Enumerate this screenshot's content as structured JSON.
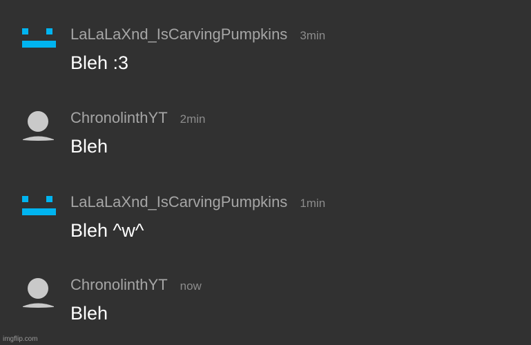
{
  "comments": [
    {
      "avatar": "face-logo-icon",
      "username": "LaLaLaXnd_IsCarvingPumpkins",
      "time": "3min",
      "message": "Bleh :3"
    },
    {
      "avatar": "default-user-icon",
      "username": "ChronolinthYT",
      "time": "2min",
      "message": "Bleh"
    },
    {
      "avatar": "face-logo-icon",
      "username": "LaLaLaXnd_IsCarvingPumpkins",
      "time": "1min",
      "message": "Bleh ^w^"
    },
    {
      "avatar": "default-user-icon",
      "username": "ChronolinthYT",
      "time": "now",
      "message": "Bleh"
    }
  ],
  "watermark": "imgflip.com",
  "colors": {
    "background": "#313131",
    "accent": "#00b4f0",
    "username": "#a6a6a6",
    "message": "#ffffff"
  }
}
